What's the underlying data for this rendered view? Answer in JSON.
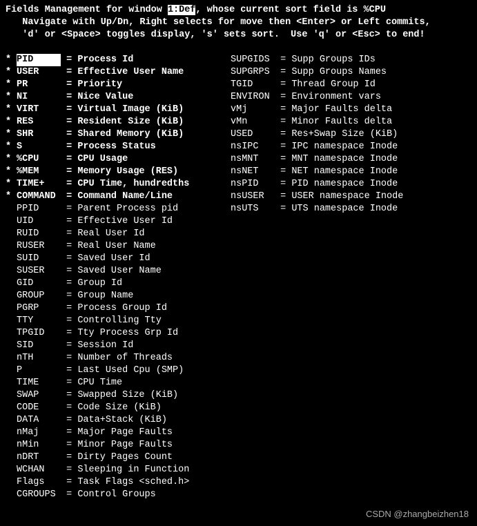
{
  "header": {
    "title": "Fields Management",
    "for_window_prefix": " for window ",
    "window_label": "1:Def",
    "sort_prefix": ", whose current sort field is ",
    "sort_field": "%CPU",
    "help_line1": "   Navigate with Up/Dn, Right selects for move then <Enter> or Left commits,",
    "help_line2": "   'd' or <Space> toggles display, 's' sets sort.  Use 'q' or <Esc> to end!"
  },
  "col1": [
    {
      "on": true,
      "sel": true,
      "name": "PID",
      "desc": "Process Id"
    },
    {
      "on": true,
      "sel": false,
      "name": "USER",
      "desc": "Effective User Name"
    },
    {
      "on": true,
      "sel": false,
      "name": "PR",
      "desc": "Priority"
    },
    {
      "on": true,
      "sel": false,
      "name": "NI",
      "desc": "Nice Value"
    },
    {
      "on": true,
      "sel": false,
      "name": "VIRT",
      "desc": "Virtual Image (KiB)"
    },
    {
      "on": true,
      "sel": false,
      "name": "RES",
      "desc": "Resident Size (KiB)"
    },
    {
      "on": true,
      "sel": false,
      "name": "SHR",
      "desc": "Shared Memory (KiB)"
    },
    {
      "on": true,
      "sel": false,
      "name": "S",
      "desc": "Process Status"
    },
    {
      "on": true,
      "sel": false,
      "name": "%CPU",
      "desc": "CPU Usage"
    },
    {
      "on": true,
      "sel": false,
      "name": "%MEM",
      "desc": "Memory Usage (RES)"
    },
    {
      "on": true,
      "sel": false,
      "name": "TIME+",
      "desc": "CPU Time, hundredths"
    },
    {
      "on": true,
      "sel": false,
      "name": "COMMAND",
      "desc": "Command Name/Line"
    },
    {
      "on": false,
      "sel": false,
      "name": "PPID",
      "desc": "Parent Process pid"
    },
    {
      "on": false,
      "sel": false,
      "name": "UID",
      "desc": "Effective User Id"
    },
    {
      "on": false,
      "sel": false,
      "name": "RUID",
      "desc": "Real User Id"
    },
    {
      "on": false,
      "sel": false,
      "name": "RUSER",
      "desc": "Real User Name"
    },
    {
      "on": false,
      "sel": false,
      "name": "SUID",
      "desc": "Saved User Id"
    },
    {
      "on": false,
      "sel": false,
      "name": "SUSER",
      "desc": "Saved User Name"
    },
    {
      "on": false,
      "sel": false,
      "name": "GID",
      "desc": "Group Id"
    },
    {
      "on": false,
      "sel": false,
      "name": "GROUP",
      "desc": "Group Name"
    },
    {
      "on": false,
      "sel": false,
      "name": "PGRP",
      "desc": "Process Group Id"
    },
    {
      "on": false,
      "sel": false,
      "name": "TTY",
      "desc": "Controlling Tty"
    },
    {
      "on": false,
      "sel": false,
      "name": "TPGID",
      "desc": "Tty Process Grp Id"
    },
    {
      "on": false,
      "sel": false,
      "name": "SID",
      "desc": "Session Id"
    },
    {
      "on": false,
      "sel": false,
      "name": "nTH",
      "desc": "Number of Threads"
    },
    {
      "on": false,
      "sel": false,
      "name": "P",
      "desc": "Last Used Cpu (SMP)"
    },
    {
      "on": false,
      "sel": false,
      "name": "TIME",
      "desc": "CPU Time"
    },
    {
      "on": false,
      "sel": false,
      "name": "SWAP",
      "desc": "Swapped Size (KiB)"
    },
    {
      "on": false,
      "sel": false,
      "name": "CODE",
      "desc": "Code Size (KiB)"
    },
    {
      "on": false,
      "sel": false,
      "name": "DATA",
      "desc": "Data+Stack (KiB)"
    },
    {
      "on": false,
      "sel": false,
      "name": "nMaj",
      "desc": "Major Page Faults"
    },
    {
      "on": false,
      "sel": false,
      "name": "nMin",
      "desc": "Minor Page Faults"
    },
    {
      "on": false,
      "sel": false,
      "name": "nDRT",
      "desc": "Dirty Pages Count"
    },
    {
      "on": false,
      "sel": false,
      "name": "WCHAN",
      "desc": "Sleeping in Function"
    },
    {
      "on": false,
      "sel": false,
      "name": "Flags",
      "desc": "Task Flags <sched.h>"
    },
    {
      "on": false,
      "sel": false,
      "name": "CGROUPS",
      "desc": "Control Groups"
    }
  ],
  "col2": [
    {
      "on": false,
      "sel": false,
      "name": "SUPGIDS",
      "desc": "Supp Groups IDs"
    },
    {
      "on": false,
      "sel": false,
      "name": "SUPGRPS",
      "desc": "Supp Groups Names"
    },
    {
      "on": false,
      "sel": false,
      "name": "TGID",
      "desc": "Thread Group Id"
    },
    {
      "on": false,
      "sel": false,
      "name": "ENVIRON",
      "desc": "Environment vars"
    },
    {
      "on": false,
      "sel": false,
      "name": "vMj",
      "desc": "Major Faults delta"
    },
    {
      "on": false,
      "sel": false,
      "name": "vMn",
      "desc": "Minor Faults delta"
    },
    {
      "on": false,
      "sel": false,
      "name": "USED",
      "desc": "Res+Swap Size (KiB)"
    },
    {
      "on": false,
      "sel": false,
      "name": "nsIPC",
      "desc": "IPC namespace Inode"
    },
    {
      "on": false,
      "sel": false,
      "name": "nsMNT",
      "desc": "MNT namespace Inode"
    },
    {
      "on": false,
      "sel": false,
      "name": "nsNET",
      "desc": "NET namespace Inode"
    },
    {
      "on": false,
      "sel": false,
      "name": "nsPID",
      "desc": "PID namespace Inode"
    },
    {
      "on": false,
      "sel": false,
      "name": "nsUSER",
      "desc": "USER namespace Inode"
    },
    {
      "on": false,
      "sel": false,
      "name": "nsUTS",
      "desc": "UTS namespace Inode"
    }
  ],
  "watermark": "CSDN @zhangbeizhen18"
}
